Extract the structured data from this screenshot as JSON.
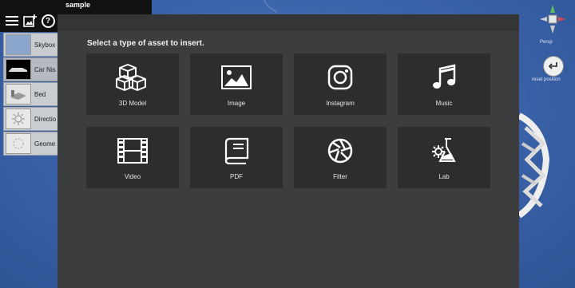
{
  "scene": {
    "title": "sample",
    "toolbar": [
      {
        "icon": "menu-icon"
      },
      {
        "icon": "add-image-icon"
      },
      {
        "icon": "help-icon",
        "glyph": "?"
      }
    ],
    "items": [
      {
        "label": "Skybox"
      },
      {
        "label": "Car Nis"
      },
      {
        "label": "Bed"
      },
      {
        "label": "Directio"
      },
      {
        "label": "Geome"
      }
    ]
  },
  "gizmo": {
    "label": "Persp",
    "button_label": "reset position"
  },
  "dialog": {
    "title": "Select a type of asset to insert.",
    "assets": [
      {
        "label": "3D Model",
        "icon": "cubes-icon"
      },
      {
        "label": "Image",
        "icon": "image-icon"
      },
      {
        "label": "Instagram",
        "icon": "instagram-icon"
      },
      {
        "label": "Music",
        "icon": "music-note-icon"
      },
      {
        "label": "Video",
        "icon": "film-icon"
      },
      {
        "label": "PDF",
        "icon": "book-icon"
      },
      {
        "label": "Filter",
        "icon": "aperture-icon"
      },
      {
        "label": "Lab",
        "icon": "flask-gear-icon"
      }
    ]
  },
  "colors": {
    "dialog_bg": "#3c3d3f",
    "tile_bg": "#2c2d2f",
    "viewport_bg": "#3a62a8"
  }
}
